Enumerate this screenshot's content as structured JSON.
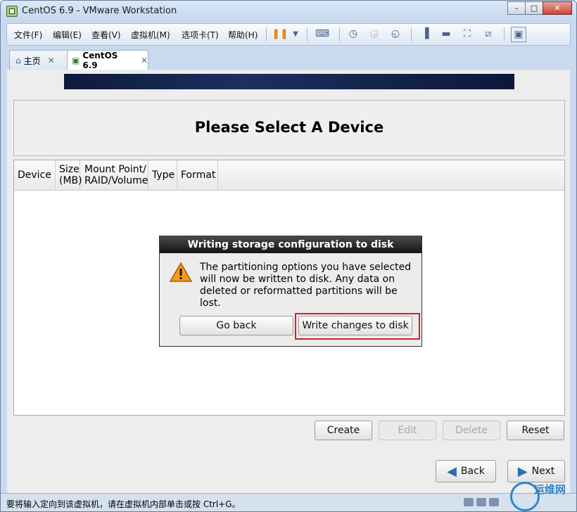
{
  "window": {
    "title": "CentOS 6.9 - VMware Workstation",
    "min": "–",
    "max": "□",
    "close": "✕"
  },
  "menubar": {
    "items": [
      "文件(F)",
      "编辑(E)",
      "查看(V)",
      "虚拟机(M)",
      "选项卡(T)",
      "帮助(H)"
    ],
    "icons": [
      "pause-icon",
      "dropdown-icon",
      "send-keys-icon",
      "snapshot-icon",
      "revert-snapshot-icon",
      "snapshot-manager-icon",
      "sidebar-icon",
      "console-icon",
      "fullscreen-icon",
      "unity-icon",
      "thumbnail-icon"
    ]
  },
  "tabs": [
    {
      "label": "主页",
      "icon": "home-icon",
      "close": "✕"
    },
    {
      "label": "CentOS 6.9",
      "icon": "vm-icon",
      "close": "✕"
    }
  ],
  "installer": {
    "heading": "Please Select A Device",
    "columns": [
      {
        "label": "Device"
      },
      {
        "label": "Size\n(MB)"
      },
      {
        "label": "Mount Point/\nRAID/Volume"
      },
      {
        "label": "Type"
      },
      {
        "label": "Format"
      }
    ],
    "buttons": {
      "create": "Create",
      "edit": "Edit",
      "delete": "Delete",
      "reset": "Reset"
    },
    "nav": {
      "back": "Back",
      "next": "Next"
    }
  },
  "dialog": {
    "title": "Writing storage configuration to disk",
    "lines": [
      "The partitioning options you have selected",
      "will now be written to disk.  Any data on",
      "deleted or reformatted partitions will be lost."
    ],
    "go_back": "Go back",
    "write": "Write changes to disk"
  },
  "status": {
    "text": "要将输入定向到该虚拟机，请在虚拟机内部单击或按 Ctrl+G。"
  },
  "watermark": {
    "text": "运维网"
  },
  "colors": {
    "highlight": "#d81f26",
    "title_bar": "#c9daf0",
    "banner": "#0d1a3a"
  }
}
